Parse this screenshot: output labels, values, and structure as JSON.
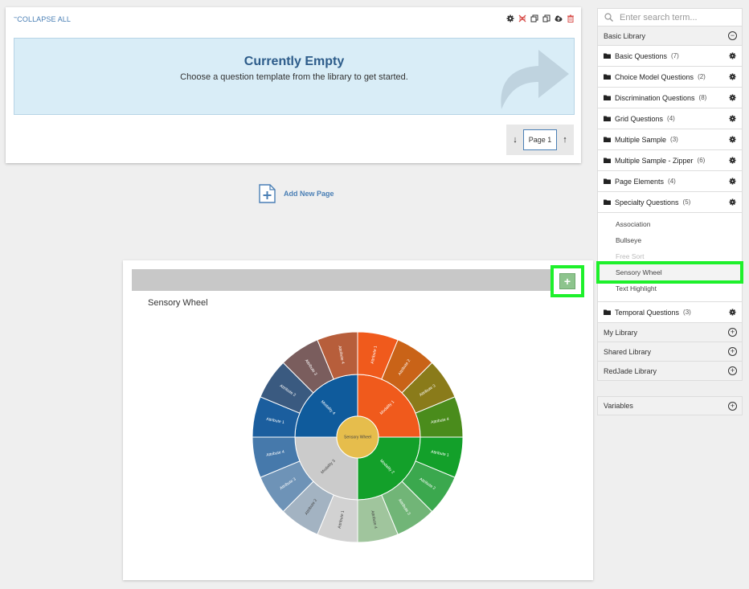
{
  "main": {
    "collapse_all": "COLLAPSE ALL",
    "empty_title": "Currently Empty",
    "empty_subtitle": "Choose a question template from the library to get started.",
    "page_label": "Page 1",
    "add_new_page": "Add New Page"
  },
  "sidebar": {
    "search_placeholder": "Enter search term...",
    "basic_library": "Basic Library",
    "categories": [
      {
        "label": "Basic Questions",
        "count": "(7)"
      },
      {
        "label": "Choice Model Questions",
        "count": "(2)"
      },
      {
        "label": "Discrimination Questions",
        "count": "(8)"
      },
      {
        "label": "Grid Questions",
        "count": "(4)"
      },
      {
        "label": "Multiple Sample",
        "count": "(3)"
      },
      {
        "label": "Multiple Sample - Zipper",
        "count": "(6)"
      },
      {
        "label": "Page Elements",
        "count": "(4)"
      },
      {
        "label": "Specialty Questions",
        "count": "(5)"
      }
    ],
    "specialty_items": [
      "Association",
      "Bullseye",
      "Free Sort",
      "Sensory Wheel",
      "Text Highlight"
    ],
    "temporal": {
      "label": "Temporal Questions",
      "count": "(3)"
    },
    "libraries": [
      "My Library",
      "Shared Library",
      "RedJade Library"
    ],
    "variables": "Variables"
  },
  "preview": {
    "title": "Sensory Wheel",
    "wheel": {
      "center_label": "Sensory Wheel",
      "center_color": "#e6bd4c",
      "modalities": [
        {
          "label": "Modality 1",
          "color": "#f05a1c",
          "attributes": [
            {
              "label": "Attribute 1",
              "color": "#f05a1c"
            },
            {
              "label": "Attribute 2",
              "color": "#c96318"
            },
            {
              "label": "Attribute 3",
              "color": "#8a7b1a"
            },
            {
              "label": "Attribute 4",
              "color": "#4a8c1c"
            }
          ]
        },
        {
          "label": "Modality 2",
          "color": "#13a02a",
          "attributes": [
            {
              "label": "Attribute 1",
              "color": "#13a02a"
            },
            {
              "label": "Attribute 2",
              "color": "#3ba84e"
            },
            {
              "label": "Attribute 3",
              "color": "#71b577"
            },
            {
              "label": "Attribute 4",
              "color": "#a0c59d"
            }
          ]
        },
        {
          "label": "Modality 3",
          "color": "#cbcbcb",
          "attributes": [
            {
              "label": "Attribute 1",
              "color": "#d2d2d2"
            },
            {
              "label": "Attribute 2",
              "color": "#a3b3c2"
            },
            {
              "label": "Attribute 3",
              "color": "#6e93b7"
            },
            {
              "label": "Attribute 4",
              "color": "#4679ab"
            }
          ]
        },
        {
          "label": "Modality 4",
          "color": "#0f5b9c",
          "attributes": [
            {
              "label": "Attribute 1",
              "color": "#1b5e9e"
            },
            {
              "label": "Attribute 2",
              "color": "#3a5a80"
            },
            {
              "label": "Attribute 3",
              "color": "#7a5d5d"
            },
            {
              "label": "Attribute 4",
              "color": "#b75e3b"
            }
          ]
        }
      ]
    }
  }
}
